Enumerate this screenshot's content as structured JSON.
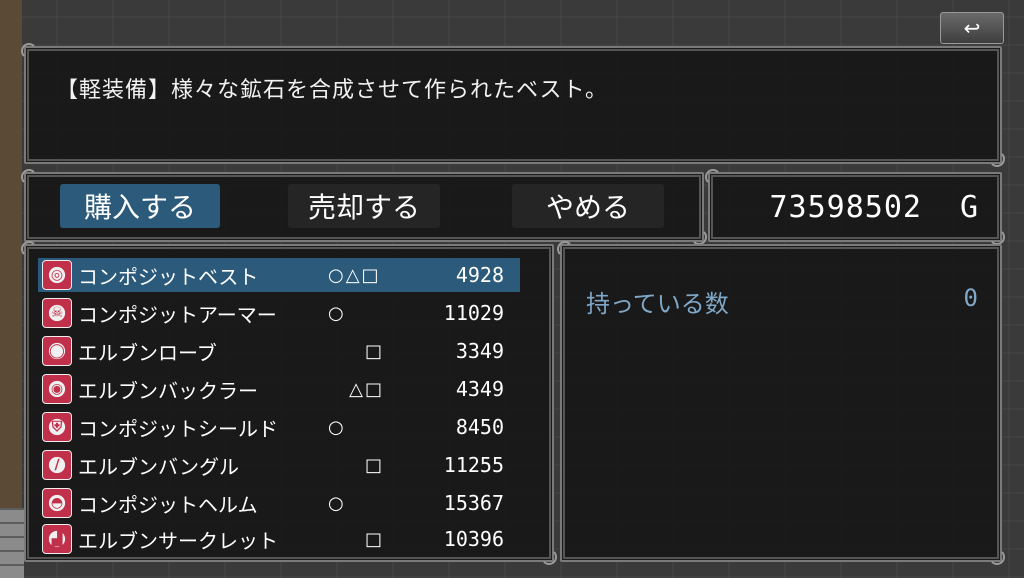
{
  "back_button": {
    "icon": "return-arrow-icon",
    "glyph": "↩"
  },
  "help": {
    "text": "【軽装備】様々な鉱石を合成させて作られたベスト。"
  },
  "commands": {
    "buy": "購入する",
    "sell": "売却する",
    "cancel": "やめる"
  },
  "gold": {
    "amount": "73598502",
    "unit": "G"
  },
  "items": [
    {
      "name": "コンポジットベスト",
      "marks": "○△□",
      "price": "4928",
      "icon": "vest-icon",
      "glyph": "◎"
    },
    {
      "name": "コンポジットアーマー",
      "marks": "○",
      "price": "11029",
      "icon": "armor-icon",
      "glyph": "☠"
    },
    {
      "name": "エルブンローブ",
      "marks": "□",
      "price": "3349",
      "icon": "robe-icon",
      "glyph": "◯"
    },
    {
      "name": "エルブンバックラー",
      "marks": "△□",
      "price": "4349",
      "icon": "buckler-icon",
      "glyph": "◉"
    },
    {
      "name": "コンポジットシールド",
      "marks": "○",
      "price": "8450",
      "icon": "shield-icon",
      "glyph": "⛨"
    },
    {
      "name": "エルブンバングル",
      "marks": "□",
      "price": "11255",
      "icon": "bangle-icon",
      "glyph": "∕"
    },
    {
      "name": "コンポジットヘルム",
      "marks": "○",
      "price": "15367",
      "icon": "helm-icon",
      "glyph": "◓"
    },
    {
      "name": "エルブンサークレット",
      "marks": "□",
      "price": "10396",
      "icon": "circlet-icon",
      "glyph": "▟"
    }
  ],
  "status": {
    "owned_label": "持っている数",
    "owned_value": "0"
  },
  "colors": {
    "selection": "#2b5a7a",
    "status_text": "#7fa8c8"
  }
}
